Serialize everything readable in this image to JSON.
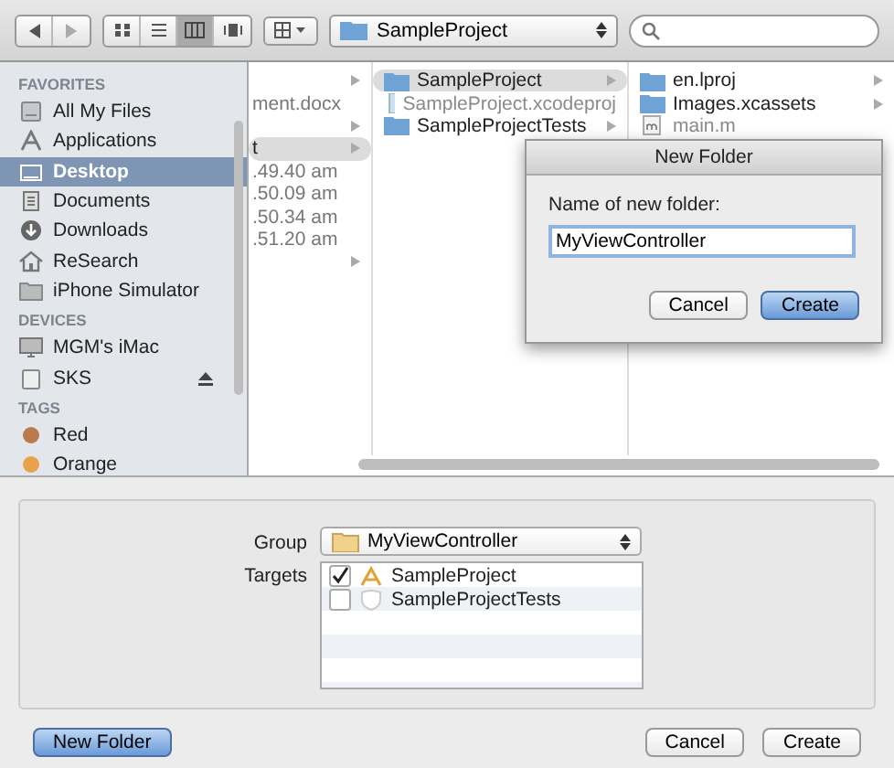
{
  "toolbar": {
    "view_modes": [
      {
        "kind": "icons",
        "selected": false
      },
      {
        "kind": "list",
        "selected": false
      },
      {
        "kind": "columns",
        "selected": true
      },
      {
        "kind": "coverflow",
        "selected": false
      }
    ],
    "path_popup": "SampleProject"
  },
  "sidebar": {
    "sections": [
      {
        "title": "FAVORITES",
        "items": [
          {
            "label": "All My Files",
            "kind": "files",
            "selected": false
          },
          {
            "label": "Applications",
            "kind": "apps",
            "selected": false
          },
          {
            "label": "Desktop",
            "kind": "desktop",
            "selected": true
          },
          {
            "label": "Documents",
            "kind": "documents",
            "selected": false
          },
          {
            "label": "Downloads",
            "kind": "downloads",
            "selected": false
          },
          {
            "label": "ReSearch",
            "kind": "home",
            "selected": false
          },
          {
            "label": "iPhone Simulator",
            "kind": "folder",
            "selected": false
          }
        ]
      },
      {
        "title": "DEVICES",
        "items": [
          {
            "label": "MGM's iMac",
            "kind": "computer",
            "selected": false
          },
          {
            "label": "SKS",
            "kind": "disk",
            "selected": false,
            "eject": true
          }
        ]
      },
      {
        "title": "TAGS",
        "items": [
          {
            "label": "Red",
            "kind": "tag",
            "color": "#b97a4e",
            "selected": false
          },
          {
            "label": "Orange",
            "kind": "tag",
            "color": "#e8a24a",
            "selected": false
          }
        ]
      }
    ]
  },
  "columns": [
    [
      {
        "kind": "text",
        "selected": false,
        "arrow": true
      },
      {
        "name": "ment.docx",
        "kind": "text",
        "selected": false,
        "arrow": false
      },
      {
        "kind": "text",
        "selected": false,
        "arrow": true
      },
      {
        "name": "t",
        "kind": "text",
        "selected": true,
        "arrow": true
      },
      {
        "name": ".49.40 am",
        "kind": "text",
        "selected": false,
        "arrow": false
      },
      {
        "name": ".50.09 am",
        "kind": "text",
        "selected": false,
        "arrow": false
      },
      {
        "name": ".50.34 am",
        "kind": "text",
        "selected": false,
        "arrow": false
      },
      {
        "name": ".51.20 am",
        "kind": "text",
        "selected": false,
        "arrow": false
      },
      {
        "kind": "text",
        "selected": false,
        "arrow": true
      }
    ],
    [
      {
        "name": "SampleProject",
        "kind": "folder",
        "selected": true,
        "arrow": true
      },
      {
        "name": "SampleProject.xcodeproj",
        "kind": "project",
        "selected": false,
        "arrow": false
      },
      {
        "name": "SampleProjectTests",
        "kind": "folder",
        "selected": false,
        "arrow": true
      }
    ],
    [
      {
        "name": "en.lproj",
        "kind": "folder",
        "selected": false,
        "arrow": true
      },
      {
        "name": "Images.xcassets",
        "kind": "folder",
        "selected": false,
        "arrow": true
      },
      {
        "name": "main.m",
        "kind": "source",
        "selected": false,
        "arrow": false
      }
    ]
  ],
  "new_folder_sheet": {
    "title": "New Folder",
    "label": "Name of new folder:",
    "value": "MyViewController",
    "buttons": [
      {
        "label": "Cancel",
        "default": false
      },
      {
        "label": "Create",
        "default": true
      }
    ]
  },
  "options": {
    "group_label": "Group",
    "group_value": "MyViewController",
    "targets_label": "Targets",
    "targets": [
      {
        "name": "SampleProject",
        "checked": true,
        "kind": "app"
      },
      {
        "name": "SampleProjectTests",
        "checked": false,
        "kind": "tests"
      }
    ]
  },
  "footer": {
    "left_buttons": [
      {
        "label": "New Folder",
        "default": true
      }
    ],
    "right_buttons": [
      {
        "label": "Cancel",
        "default": false
      },
      {
        "label": "Create",
        "default": false
      }
    ]
  }
}
